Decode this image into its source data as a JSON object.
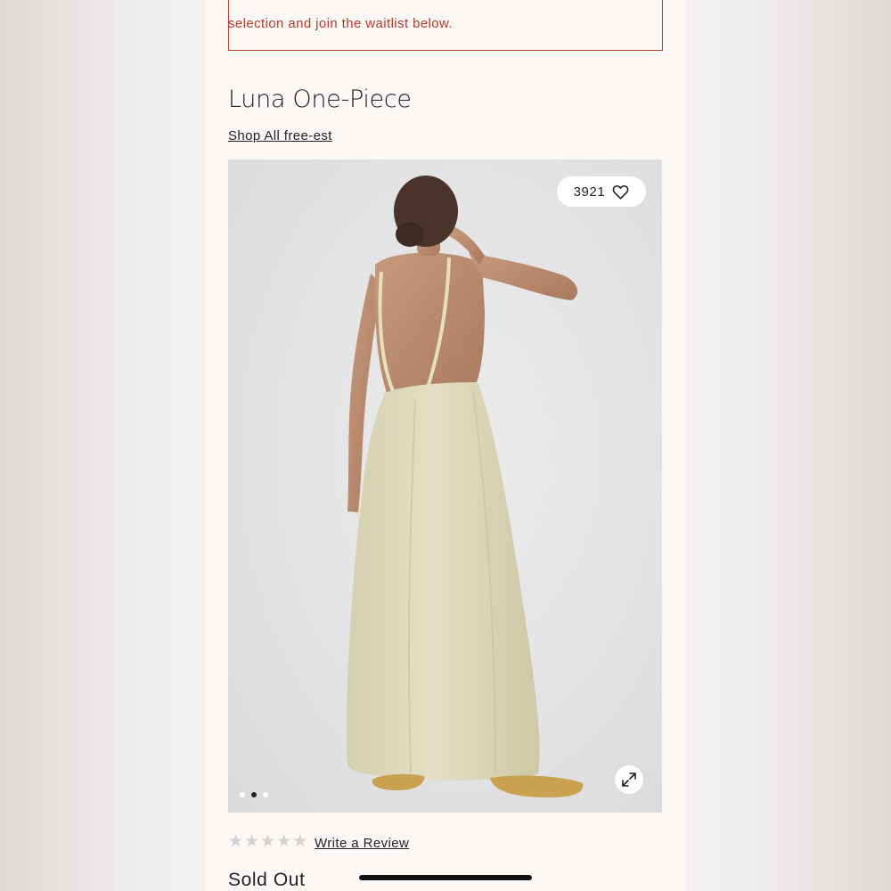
{
  "waitlist": {
    "message": "selection and join the waitlist below."
  },
  "product": {
    "title": "Luna One-Piece",
    "shop_link": "Shop All free-est",
    "favorites_count": "3921",
    "rating_stars": 0,
    "rating_max": 5,
    "write_review": "Write a Review",
    "status": "Sold Out"
  },
  "gallery": {
    "image_count": 3,
    "active_index": 1
  },
  "icons": {
    "heart": "heart-icon",
    "expand": "expand-icon",
    "star": "star-icon"
  },
  "colors": {
    "accent_red": "#b53b2d",
    "page_bg": "#fcf8f6",
    "text": "#222222"
  }
}
